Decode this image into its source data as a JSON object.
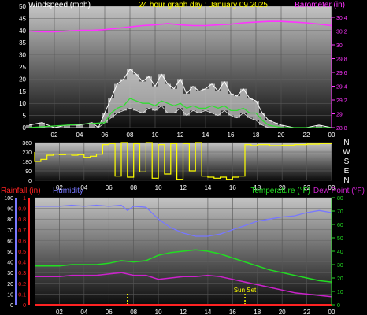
{
  "colors": {
    "windspeed": "#ffffff",
    "gust_avg": "#33dd33",
    "barometer": "#ff33ff",
    "direction": "#ffff00",
    "rainfall": "#ff2222",
    "humidity": "#7777ff",
    "temperature": "#22dd22",
    "dewpoint": "#cc22cc",
    "title": "#ffff00",
    "sunset": "#ffff00"
  },
  "top": {
    "title": "24 hour graph day : January 09 2025",
    "left_label": "Windspeed (mph)",
    "right_label": "Barometer (in)"
  },
  "bottom": {
    "rain_label": "Rainfall (in)",
    "humidity_label": "Humidity",
    "temperature_label": "Temperature (°F)",
    "dewpoint_label": "Dew Point (°F)",
    "sunset_label": "Sun Set"
  },
  "chart_data": [
    {
      "type": "line",
      "title": "24 hour graph day : January 09 2025",
      "xlabel": "",
      "x_ticks": [
        "02",
        "04",
        "06",
        "08",
        "10",
        "12",
        "14",
        "16",
        "18",
        "20",
        "22",
        "00"
      ],
      "y_left": {
        "label": "Windspeed (mph)",
        "range": [
          0,
          50
        ],
        "ticks": [
          "0",
          "5",
          "10",
          "15",
          "20",
          "25",
          "30",
          "35",
          "40",
          "45",
          "50"
        ]
      },
      "y_right": {
        "label": "Barometer (in)",
        "range": [
          28.8,
          30.4
        ],
        "ticks": [
          "28.8",
          "29",
          "29.2",
          "29.4",
          "29.6",
          "29.8",
          "30",
          "30.2",
          "30.4"
        ]
      },
      "series": [
        {
          "name": "Barometer (in)",
          "axis": "right",
          "x": [
            0,
            1,
            2,
            3,
            4,
            5,
            6,
            7,
            8,
            9,
            10,
            11,
            12,
            13,
            14,
            15,
            16,
            17,
            18,
            19,
            20,
            21,
            22,
            23,
            24
          ],
          "values": [
            30.2,
            30.19,
            30.19,
            30.2,
            30.21,
            30.21,
            30.22,
            30.24,
            30.26,
            30.28,
            30.29,
            30.31,
            30.29,
            30.28,
            30.28,
            30.29,
            30.3,
            30.32,
            30.33,
            30.34,
            30.34,
            30.33,
            30.32,
            30.3,
            30.28
          ]
        },
        {
          "name": "Windspeed (mph)",
          "axis": "left",
          "x": [
            0,
            1,
            2,
            3,
            4,
            5,
            5.5,
            6,
            6.5,
            7,
            7.5,
            8,
            8.5,
            9,
            9.5,
            10,
            10.5,
            11,
            11.5,
            12,
            12.5,
            13,
            13.5,
            14,
            14.5,
            15,
            15.5,
            16,
            16.5,
            17,
            17.5,
            18,
            18.5,
            19,
            19.5,
            20,
            21,
            22,
            23,
            24
          ],
          "values": [
            1,
            2,
            0,
            1,
            1,
            2,
            0,
            6,
            12,
            18,
            20,
            24,
            22,
            19,
            21,
            17,
            22,
            18,
            16,
            20,
            14,
            17,
            15,
            16,
            18,
            15,
            19,
            14,
            13,
            16,
            12,
            11,
            6,
            3,
            2,
            1,
            0,
            0,
            1,
            0
          ],
          "min_values": [
            0,
            0,
            0,
            0,
            0,
            0,
            0,
            2,
            4,
            6,
            7,
            8,
            7,
            6,
            8,
            7,
            9,
            6,
            6,
            8,
            5,
            7,
            6,
            7,
            6,
            5,
            7,
            5,
            4,
            6,
            4,
            3,
            1,
            0,
            0,
            0,
            0,
            0,
            0,
            0
          ]
        },
        {
          "name": "Average windspeed (mph)",
          "axis": "left",
          "x": [
            0,
            6,
            6.5,
            7,
            7.5,
            8,
            8.5,
            9,
            9.5,
            10,
            10.5,
            11,
            11.5,
            12,
            12.5,
            13,
            13.5,
            14,
            14.5,
            15,
            15.5,
            16,
            16.5,
            17,
            17.5,
            18,
            18.5,
            19,
            20,
            24
          ],
          "values": [
            0,
            2,
            6,
            8,
            9,
            12,
            11,
            10,
            10,
            9,
            11,
            10,
            9,
            10,
            8,
            9,
            8,
            8,
            9,
            8,
            9,
            7,
            7,
            8,
            6,
            6,
            3,
            1,
            0,
            0
          ]
        }
      ]
    },
    {
      "type": "line",
      "title": "",
      "x_ticks": [
        "02",
        "04",
        "06",
        "08",
        "10",
        "12",
        "14",
        "16",
        "18",
        "20",
        "22",
        "00"
      ],
      "y_left": {
        "label": "",
        "range": [
          0,
          360
        ],
        "ticks": [
          "0",
          "90",
          "180",
          "270",
          "360"
        ]
      },
      "y_right_labels": [
        "N",
        "W",
        "S",
        "E",
        "N"
      ],
      "series": [
        {
          "name": "Wind direction",
          "x": [
            0,
            0.5,
            1,
            1.5,
            2,
            2.5,
            3,
            3.5,
            4,
            4.5,
            5,
            5.5,
            6,
            6.5,
            7,
            7.5,
            8,
            8.5,
            9,
            9.5,
            10,
            10.5,
            11,
            11.5,
            12,
            12.5,
            13,
            13.5,
            14,
            14.5,
            15,
            15.5,
            16,
            16.5,
            17,
            17.5,
            18,
            18.5,
            19,
            20,
            21,
            22,
            23,
            24
          ],
          "values": [
            270,
            180,
            200,
            240,
            250,
            245,
            250,
            240,
            245,
            220,
            230,
            250,
            340,
            350,
            40,
            360,
            30,
            350,
            80,
            360,
            20,
            340,
            60,
            350,
            10,
            350,
            90,
            360,
            40,
            30,
            20,
            30,
            10,
            30,
            40,
            340,
            330,
            340,
            340,
            330,
            335,
            340,
            345,
            350
          ]
        }
      ]
    },
    {
      "type": "line",
      "title": "",
      "x_ticks": [
        "02",
        "04",
        "06",
        "08",
        "10",
        "12",
        "14",
        "16",
        "18",
        "20",
        "22",
        "00"
      ],
      "y_left_outer": {
        "label": "Rainfall (in)",
        "range": [
          0,
          1
        ],
        "ticks": [
          "0",
          "0.1",
          "0.2",
          "0.3",
          "0.4",
          "0.5",
          "0.6",
          "0.7",
          "0.8",
          "0.9",
          "1"
        ]
      },
      "y_left": {
        "label": "Humidity",
        "range": [
          0,
          100
        ],
        "ticks": [
          "0",
          "10",
          "20",
          "30",
          "40",
          "50",
          "60",
          "70",
          "80",
          "90",
          "100"
        ]
      },
      "y_right": {
        "label": "Temperature (°F)",
        "range": [
          0,
          80
        ],
        "ticks": [
          "0",
          "10",
          "20",
          "30",
          "40",
          "50",
          "60",
          "70",
          "80"
        ]
      },
      "annotations": [
        {
          "text": "Sun Set",
          "x": 17
        }
      ],
      "markers_x": [
        7.5,
        17
      ],
      "series": [
        {
          "name": "Humidity",
          "axis": "left",
          "x": [
            0,
            1,
            2,
            3,
            4,
            5,
            6,
            7,
            7.5,
            8,
            9,
            10,
            11,
            12,
            13,
            14,
            15,
            16,
            17,
            18,
            19,
            20,
            21,
            22,
            23,
            24
          ],
          "values": [
            92,
            92,
            92,
            93,
            92,
            93,
            92,
            93,
            88,
            92,
            91,
            80,
            72,
            67,
            64,
            64,
            66,
            70,
            74,
            78,
            80,
            82,
            83,
            86,
            88,
            86
          ]
        },
        {
          "name": "Temperature (°F)",
          "axis": "right",
          "x": [
            0,
            1,
            2,
            3,
            4,
            5,
            6,
            7,
            8,
            9,
            10,
            11,
            12,
            13,
            14,
            15,
            16,
            17,
            18,
            19,
            20,
            21,
            22,
            23,
            24
          ],
          "values": [
            29,
            29,
            29,
            30,
            30,
            30,
            31,
            33,
            32,
            33,
            37,
            39,
            40,
            41,
            40,
            38,
            35,
            32,
            29,
            26,
            24,
            22,
            20,
            18,
            17
          ]
        },
        {
          "name": "Dew Point (°F)",
          "axis": "right",
          "x": [
            0,
            1,
            2,
            3,
            4,
            5,
            6,
            7,
            8,
            9,
            10,
            11,
            12,
            13,
            14,
            15,
            16,
            17,
            18,
            19,
            20,
            21,
            22,
            23,
            24
          ],
          "values": [
            21,
            21,
            21,
            22,
            22,
            22,
            23,
            24,
            22,
            22,
            19,
            20,
            21,
            21,
            22,
            21,
            19,
            17,
            15,
            13,
            11,
            9,
            8,
            7,
            6
          ]
        },
        {
          "name": "Rainfall (in)",
          "axis": "left_outer",
          "x": [
            0,
            24
          ],
          "values": [
            0,
            0
          ]
        }
      ]
    }
  ]
}
